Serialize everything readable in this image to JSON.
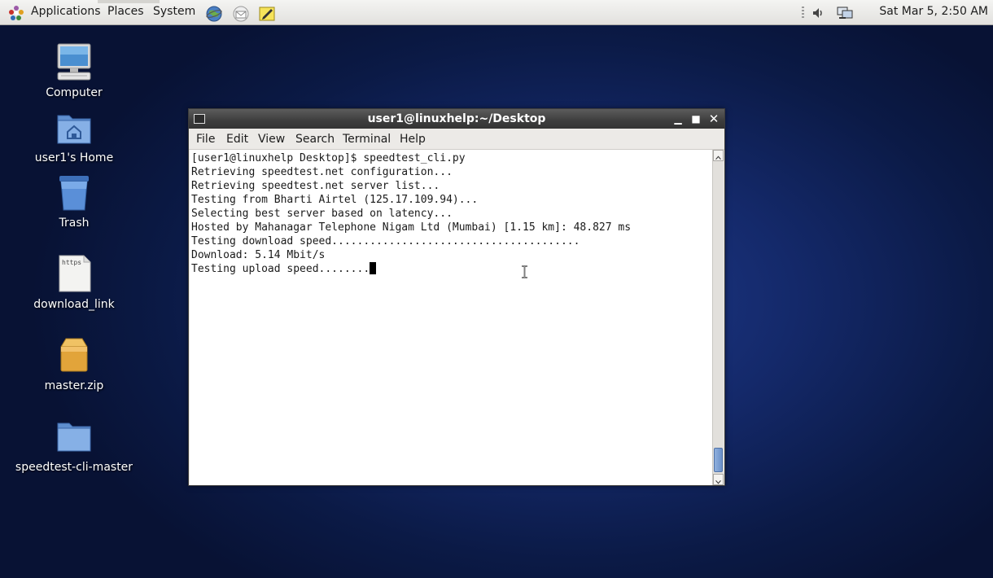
{
  "panel": {
    "menus": [
      "Applications",
      "Places",
      "System"
    ],
    "clock": "Sat Mar  5,  2:50 AM"
  },
  "desktop": {
    "icons": [
      {
        "label": "Computer",
        "icon": "computer-icon"
      },
      {
        "label": "user1's Home",
        "icon": "home-folder-icon"
      },
      {
        "label": "Trash",
        "icon": "trash-icon"
      },
      {
        "label": "download_link",
        "icon": "text-file-icon",
        "file_tag": "https"
      },
      {
        "label": "master.zip",
        "icon": "archive-icon"
      },
      {
        "label": "speedtest-cli-master",
        "icon": "folder-icon"
      }
    ]
  },
  "terminal": {
    "title": "user1@linuxhelp:~/Desktop",
    "menu": [
      "File",
      "Edit",
      "View",
      "Search",
      "Terminal",
      "Help"
    ],
    "lines": [
      "[user1@linuxhelp Desktop]$ speedtest_cli.py",
      "Retrieving speedtest.net configuration...",
      "Retrieving speedtest.net server list...",
      "Testing from Bharti Airtel (125.17.109.94)...",
      "Selecting best server based on latency...",
      "Hosted by Mahanagar Telephone Nigam Ltd (Mumbai) [1.15 km]: 48.827 ms",
      "Testing download speed.......................................",
      "Download: 5.14 Mbit/s",
      "Testing upload speed........"
    ]
  },
  "colors": {
    "desktop_bg": "#14296a",
    "titlebar": "#3d3d3d",
    "scroll_thumb": "#6b90c8"
  }
}
